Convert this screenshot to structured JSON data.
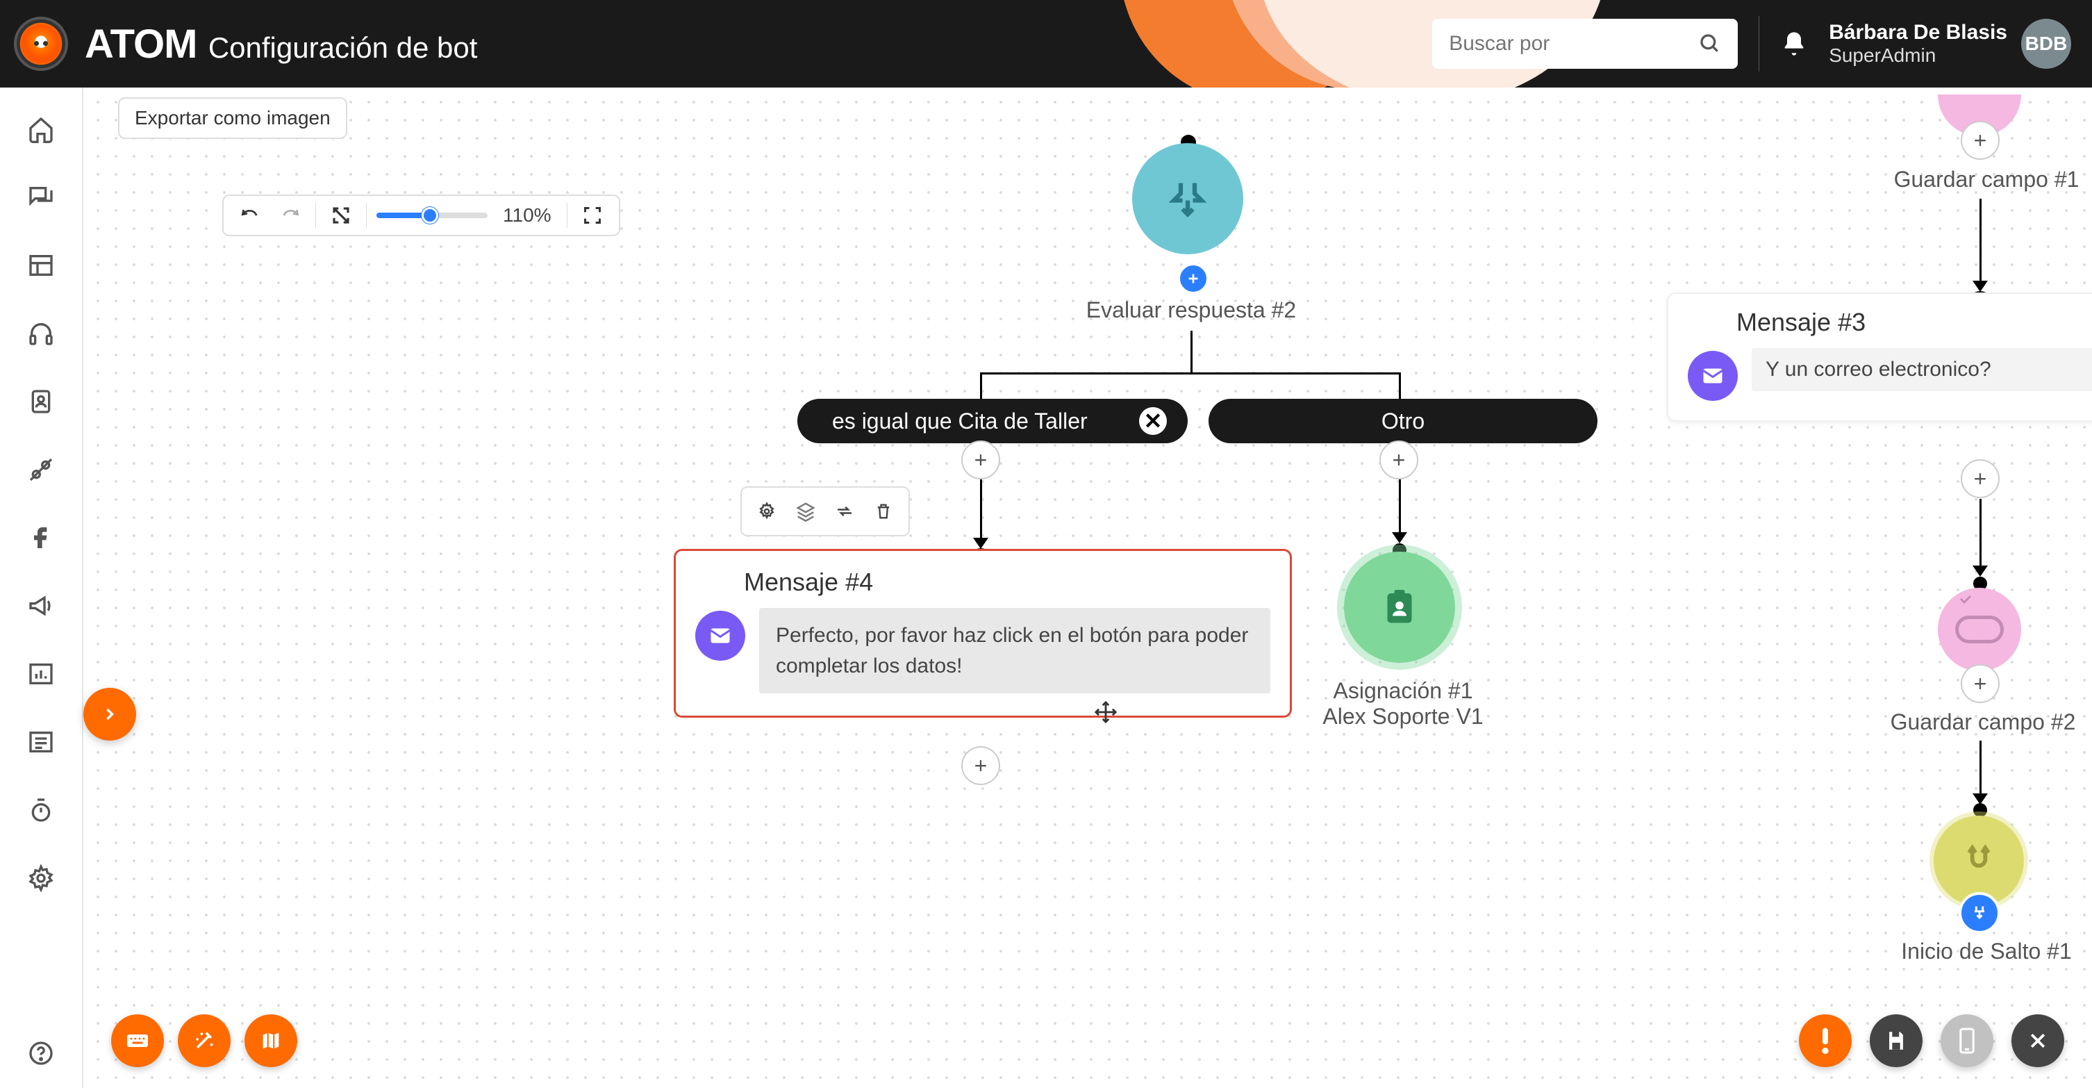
{
  "app": {
    "name": "ATOM",
    "page_title": "Configuración de bot"
  },
  "search": {
    "placeholder": "Buscar por"
  },
  "user": {
    "fullname": "Bárbara De Blasis",
    "role": "SuperAdmin",
    "initials": "BDB"
  },
  "toolbar": {
    "zoom_label": "110%",
    "export_label": "Exportar como imagen"
  },
  "nodes": {
    "evaluator": {
      "label": "Evaluar respuesta #2"
    },
    "branch_equal": {
      "label": "es igual que Cita de Taller"
    },
    "branch_other": {
      "label": "Otro"
    },
    "message4": {
      "title": "Mensaje #4",
      "text": "Perfecto, por favor haz click en el botón para poder completar los datos!"
    },
    "message3": {
      "title": "Mensaje #3",
      "text": "Y un correo electronico?"
    },
    "assignment": {
      "line1": "Asignación #1",
      "line2": "Alex Soporte V1"
    },
    "savefield1": {
      "label": "Guardar campo #1"
    },
    "savefield2": {
      "label": "Guardar campo #2"
    },
    "jump": {
      "label": "Inicio de Salto #1"
    }
  },
  "colors": {
    "accent_orange": "#ff6b00",
    "accent_blue": "#2b7fff",
    "evaluator_teal": "#6fc7d4",
    "assignment_green": "#4caf7d",
    "mail_purple": "#7a5af5",
    "savefield_pink": "#f5b8e0",
    "jump_yellow": "#dcdb6f",
    "selected_border": "#d94a3a"
  }
}
